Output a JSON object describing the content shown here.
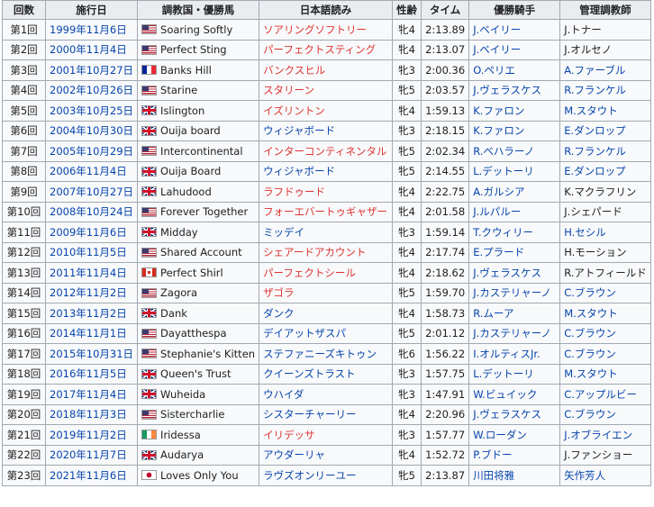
{
  "headers": [
    "回数",
    "施行日",
    "調教国・優勝馬",
    "日本語読み",
    "性齢",
    "タイム",
    "優勝騎手",
    "管理調教師"
  ],
  "rows": [
    {
      "no": "第1回",
      "date": "1999年11月6日",
      "flag": "usa",
      "horse": "Soaring Softly",
      "reading": "ソアリングソフトリー",
      "reading_red": true,
      "age": "牝4",
      "time": "2:13.89",
      "jockey": "J.ベイリー",
      "trainer": "J.トナー",
      "jockey_link": true,
      "trainer_link": false
    },
    {
      "no": "第2回",
      "date": "2000年11月4日",
      "flag": "usa",
      "horse": "Perfect Sting",
      "reading": "パーフェクトスティング",
      "reading_red": true,
      "age": "牝4",
      "time": "2:13.07",
      "jockey": "J.ベイリー",
      "trainer": "J.オルセノ",
      "jockey_link": true,
      "trainer_link": false
    },
    {
      "no": "第3回",
      "date": "2001年10月27日",
      "flag": "fra",
      "horse": "Banks Hill",
      "reading": "バンクスヒル",
      "reading_red": true,
      "age": "牝3",
      "time": "2:00.36",
      "jockey": "O.ペリエ",
      "trainer": "A.ファーブル",
      "jockey_link": true,
      "trainer_link": true
    },
    {
      "no": "第4回",
      "date": "2002年10月26日",
      "flag": "usa",
      "horse": "Starine",
      "reading": "スタリーン",
      "reading_red": true,
      "age": "牝5",
      "time": "2:03.57",
      "jockey": "J.ヴェラスケス",
      "trainer": "R.フランケル",
      "jockey_link": true,
      "trainer_link": true
    },
    {
      "no": "第5回",
      "date": "2003年10月25日",
      "flag": "gbr",
      "horse": "Islington",
      "reading": "イズリントン",
      "reading_red": true,
      "age": "牝4",
      "time": "1:59.13",
      "jockey": "K.ファロン",
      "trainer": "M.スタウト",
      "jockey_link": true,
      "trainer_link": true
    },
    {
      "no": "第6回",
      "date": "2004年10月30日",
      "flag": "gbr",
      "horse": "Ouija board",
      "reading": "ウィジャボード",
      "reading_red": false,
      "age": "牝3",
      "time": "2:18.15",
      "jockey": "K.ファロン",
      "trainer": "E.ダンロップ",
      "jockey_link": true,
      "trainer_link": true
    },
    {
      "no": "第7回",
      "date": "2005年10月29日",
      "flag": "usa",
      "horse": "Intercontinental",
      "reading": "インターコンティネンタル",
      "reading_red": true,
      "age": "牝5",
      "time": "2:02.34",
      "jockey": "R.ベハラーノ",
      "trainer": "R.フランケル",
      "jockey_link": true,
      "trainer_link": true
    },
    {
      "no": "第8回",
      "date": "2006年11月4日",
      "flag": "gbr",
      "horse": "Ouija Board",
      "reading": "ウィジャボード",
      "reading_red": false,
      "age": "牝5",
      "time": "2:14.55",
      "jockey": "L.デットーリ",
      "trainer": "E.ダンロップ",
      "jockey_link": true,
      "trainer_link": true
    },
    {
      "no": "第9回",
      "date": "2007年10月27日",
      "flag": "gbr",
      "horse": "Lahudood",
      "reading": "ラフドゥード",
      "reading_red": true,
      "age": "牝4",
      "time": "2:22.75",
      "jockey": "A.ガルシア",
      "trainer": "K.マクラフリン",
      "jockey_link": true,
      "trainer_link": false
    },
    {
      "no": "第10回",
      "date": "2008年10月24日",
      "flag": "usa",
      "horse": "Forever Together",
      "reading": "フォーエバートゥギャザー",
      "reading_red": true,
      "age": "牝4",
      "time": "2:01.58",
      "jockey": "J.ルパルー",
      "trainer": "J.シェパード",
      "jockey_link": true,
      "trainer_link": false
    },
    {
      "no": "第11回",
      "date": "2009年11月6日",
      "flag": "gbr",
      "horse": "Midday",
      "reading": "ミッデイ",
      "reading_red": false,
      "age": "牝3",
      "time": "1:59.14",
      "jockey": "T.クウィリー",
      "trainer": "H.セシル",
      "jockey_link": true,
      "trainer_link": true
    },
    {
      "no": "第12回",
      "date": "2010年11月5日",
      "flag": "usa",
      "horse": "Shared Account",
      "reading": "シェアードアカウント",
      "reading_red": true,
      "age": "牝4",
      "time": "2:17.74",
      "jockey": "E.プラード",
      "trainer": "H.モーション",
      "jockey_link": true,
      "trainer_link": false
    },
    {
      "no": "第13回",
      "date": "2011年11月4日",
      "flag": "can",
      "horse": "Perfect Shirl",
      "reading": "パーフェクトシール",
      "reading_red": true,
      "age": "牝4",
      "time": "2:18.62",
      "jockey": "J.ヴェラスケス",
      "trainer": "R.アトフィールド",
      "jockey_link": true,
      "trainer_link": false
    },
    {
      "no": "第14回",
      "date": "2012年11月2日",
      "flag": "usa",
      "horse": "Zagora",
      "reading": "ザゴラ",
      "reading_red": true,
      "age": "牝5",
      "time": "1:59.70",
      "jockey": "J.カステリャーノ",
      "trainer": "C.ブラウン",
      "jockey_link": true,
      "trainer_link": true
    },
    {
      "no": "第15回",
      "date": "2013年11月2日",
      "flag": "gbr",
      "horse": "Dank",
      "reading": "ダンク",
      "reading_red": false,
      "age": "牝4",
      "time": "1:58.73",
      "jockey": "R.ムーア",
      "trainer": "M.スタウト",
      "jockey_link": true,
      "trainer_link": true
    },
    {
      "no": "第16回",
      "date": "2014年11月1日",
      "flag": "usa",
      "horse": "Dayatthespa",
      "reading": "デイアットザスパ",
      "reading_red": false,
      "age": "牝5",
      "time": "2:01.12",
      "jockey": "J.カステリャーノ",
      "trainer": "C.ブラウン",
      "jockey_link": true,
      "trainer_link": true
    },
    {
      "no": "第17回",
      "date": "2015年10月31日",
      "flag": "usa",
      "horse": "Stephanie's Kitten",
      "reading": "ステファニーズキトゥン",
      "reading_red": false,
      "age": "牝6",
      "time": "1:56.22",
      "jockey": "I.オルティスJr.",
      "trainer": "C.ブラウン",
      "jockey_link": true,
      "trainer_link": true
    },
    {
      "no": "第18回",
      "date": "2016年11月5日",
      "flag": "gbr",
      "horse": "Queen's Trust",
      "reading": "クイーンズトラスト",
      "reading_red": false,
      "age": "牝3",
      "time": "1:57.75",
      "jockey": "L.デットーリ",
      "trainer": "M.スタウト",
      "jockey_link": true,
      "trainer_link": true
    },
    {
      "no": "第19回",
      "date": "2017年11月4日",
      "flag": "gbr",
      "horse": "Wuheida",
      "reading": "ウハイダ",
      "reading_red": false,
      "age": "牝3",
      "time": "1:47.91",
      "jockey": "W.ビュイック",
      "trainer": "C.アップルビー",
      "jockey_link": true,
      "trainer_link": true
    },
    {
      "no": "第20回",
      "date": "2018年11月3日",
      "flag": "usa",
      "horse": "Sistercharlie",
      "reading": "シスターチャーリー",
      "reading_red": false,
      "age": "牝4",
      "time": "2:20.96",
      "jockey": "J.ヴェラスケス",
      "trainer": "C.ブラウン",
      "jockey_link": true,
      "trainer_link": true
    },
    {
      "no": "第21回",
      "date": "2019年11月2日",
      "flag": "irl",
      "horse": "Iridessa",
      "reading": "イリデッサ",
      "reading_red": true,
      "age": "牝3",
      "time": "1:57.77",
      "jockey": "W.ローダン",
      "trainer": "J.オブライエン",
      "jockey_link": true,
      "trainer_link": true
    },
    {
      "no": "第22回",
      "date": "2020年11月7日",
      "flag": "gbr",
      "horse": "Audarya",
      "reading": "アウダーリャ",
      "reading_red": false,
      "age": "牝4",
      "time": "1:52.72",
      "jockey": "P.ブドー",
      "trainer": "J.ファンショー",
      "jockey_link": true,
      "trainer_link": false
    },
    {
      "no": "第23回",
      "date": "2021年11月6日",
      "flag": "jpn",
      "horse": "Loves Only You",
      "reading": "ラヴズオンリーユー",
      "reading_red": false,
      "age": "牝5",
      "time": "2:13.87",
      "jockey": "川田将雅",
      "trainer": "矢作芳人",
      "jockey_link": true,
      "trainer_link": true
    }
  ]
}
